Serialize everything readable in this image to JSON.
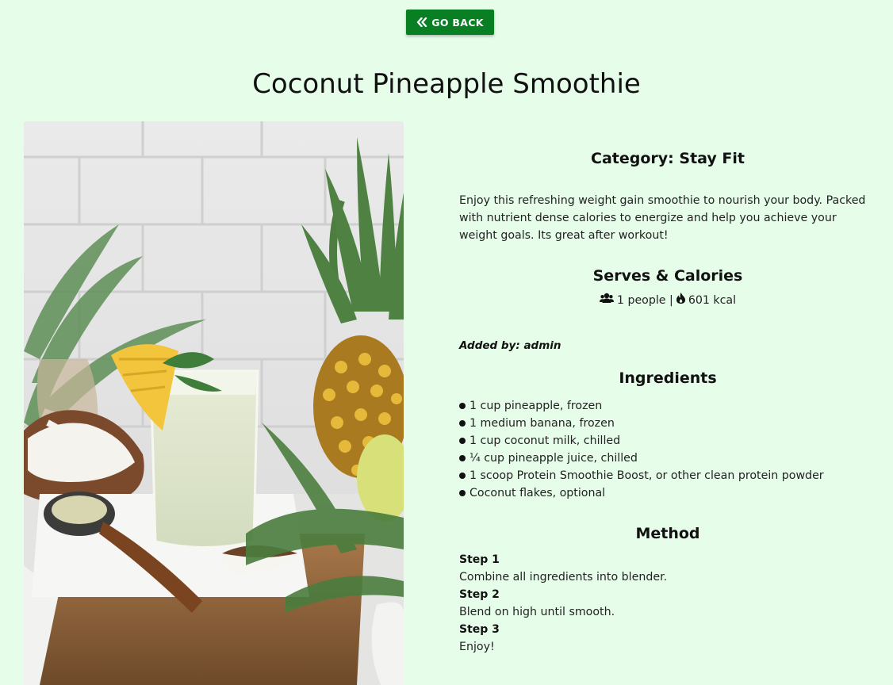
{
  "nav": {
    "back_label": "GO BACK",
    "back_icon": "double-chevron-left-icon"
  },
  "recipe": {
    "title": "Coconut Pineapple Smoothie",
    "category": "Category: Stay Fit",
    "description": "Enjoy this refreshing weight gain smoothie to nourish your body. Packed with nutrient dense calories to energize and help you achieve your weight goals. Its great after workout!",
    "serves_heading": "Serves & Calories",
    "serves_text": "1 people |",
    "calories_text": "601 kcal",
    "serves_icon": "users-icon",
    "calories_icon": "fire-icon",
    "added_by": "Added by: admin",
    "ingredients_heading": "Ingredients",
    "ingredients": [
      "1 cup pineapple, frozen",
      "1 medium banana, frozen",
      "1 cup coconut milk, chilled",
      "¼ cup pineapple juice, chilled",
      "1 scoop Protein Smoothie Boost, or other clean protein powder",
      "Coconut flakes, optional"
    ],
    "method_heading": "Method",
    "steps": [
      {
        "label": "Step 1",
        "text": "Combine all ingredients into blender."
      },
      {
        "label": "Step 2",
        "text": "Blend on high until smooth."
      },
      {
        "label": "Step 3",
        "text": "Enjoy!"
      }
    ]
  },
  "colors": {
    "background": "#e6fdea",
    "button": "#087f23",
    "button_text": "#ffffff"
  }
}
